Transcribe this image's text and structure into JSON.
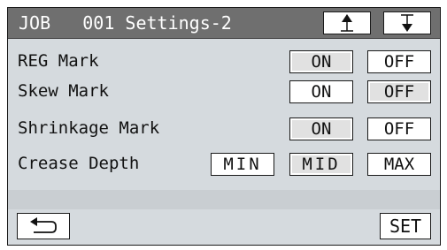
{
  "header": {
    "title": "JOB   001 Settings-2",
    "up_icon": "scroll-up-icon",
    "down_icon": "scroll-down-icon"
  },
  "rows": [
    {
      "label": "REG Mark",
      "options": [
        "ON",
        "OFF"
      ],
      "selected": "ON"
    },
    {
      "label": "Skew Mark",
      "options": [
        "ON",
        "OFF"
      ],
      "selected": "OFF"
    },
    {
      "label": "Shrinkage Mark",
      "options": [
        "ON",
        "OFF"
      ],
      "selected": "ON"
    },
    {
      "label": "Crease Depth",
      "options": [
        "MIN",
        "MID",
        "MAX"
      ],
      "selected": "MID"
    }
  ],
  "footer": {
    "back_icon": "return-icon",
    "set_label": "SET"
  },
  "colors": {
    "header_bg": "#6f6f6f",
    "panel_bg": "#d5dade",
    "selected_bg": "#e1e1e1",
    "button_bg": "#ffffff"
  }
}
